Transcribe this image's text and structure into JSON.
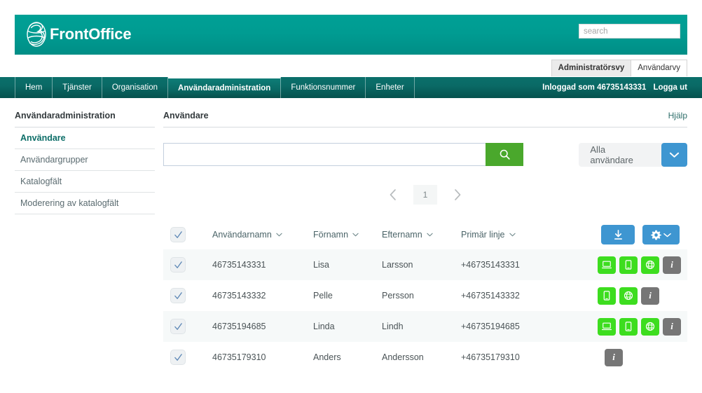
{
  "brand": {
    "name": "FrontOffice",
    "logo_icon": "three-logo-icon",
    "banner_color": "#009c92"
  },
  "topbar": {
    "search_placeholder": "search",
    "search_value": ""
  },
  "view_tabs": [
    {
      "label": "Administratörsvy",
      "active": true
    },
    {
      "label": "Användarvy",
      "active": false
    }
  ],
  "nav": {
    "items": [
      {
        "label": "Hem",
        "active": false
      },
      {
        "label": "Tjänster",
        "active": false
      },
      {
        "label": "Organisation",
        "active": false
      },
      {
        "label": "Användaradministration",
        "active": true
      },
      {
        "label": "Funktionsnummer",
        "active": false
      },
      {
        "label": "Enheter",
        "active": false
      }
    ],
    "logged_in_as": "Inloggad som 46735143331",
    "logout": "Logga ut"
  },
  "sidebar": {
    "title": "Användaradministration",
    "items": [
      {
        "label": "Användare",
        "active": true
      },
      {
        "label": "Användargrupper",
        "active": false
      },
      {
        "label": "Katalogfält",
        "active": false
      },
      {
        "label": "Moderering av katalogfält",
        "active": false
      }
    ]
  },
  "main": {
    "title": "Användare",
    "help_label": "Hjälp",
    "search": {
      "value": "",
      "placeholder": "",
      "button_icon": "search-icon"
    },
    "filter": {
      "label": "Alla användare",
      "chevron_icon": "chevron-down-icon"
    },
    "pagination": {
      "prev_icon": "chevron-left-icon",
      "next_icon": "chevron-right-icon",
      "current_page": "1"
    },
    "toolbar": {
      "download_icon": "download-icon",
      "settings_icon": "gear-icon",
      "settings_chevron_icon": "chevron-down-icon"
    },
    "table": {
      "columns": [
        {
          "label": "Användarnamn",
          "sort_icon": "chevron-down-icon"
        },
        {
          "label": "Förnamn",
          "sort_icon": "chevron-down-icon"
        },
        {
          "label": "Efternamn",
          "sort_icon": "chevron-down-icon"
        },
        {
          "label": "Primär linje",
          "sort_icon": "chevron-down-icon"
        }
      ],
      "rows": [
        {
          "username": "46735143331",
          "first_name": "Lisa",
          "last_name": "Larsson",
          "primary_line": "+46735143331",
          "icons": [
            "desktop-icon",
            "mobile-icon",
            "web-icon"
          ],
          "info_label": "i"
        },
        {
          "username": "46735143332",
          "first_name": "Pelle",
          "last_name": "Persson",
          "primary_line": "+46735143332",
          "icons": [
            "mobile-icon",
            "web-icon"
          ],
          "info_label": "i"
        },
        {
          "username": "46735194685",
          "first_name": "Linda",
          "last_name": "Lindh",
          "primary_line": "+46735194685",
          "icons": [
            "desktop-icon",
            "mobile-icon",
            "web-icon"
          ],
          "info_label": "i"
        },
        {
          "username": "46735179310",
          "first_name": "Anders",
          "last_name": "Andersson",
          "primary_line": "+46735179310",
          "icons": [],
          "info_label": "i"
        }
      ]
    }
  },
  "colors": {
    "teal": "#009c92",
    "nav_dark": "#0a6a66",
    "green": "#4aa82c",
    "icon_green": "#3ddd1f",
    "blue": "#3e96d1",
    "gray_pill": "#767676"
  }
}
